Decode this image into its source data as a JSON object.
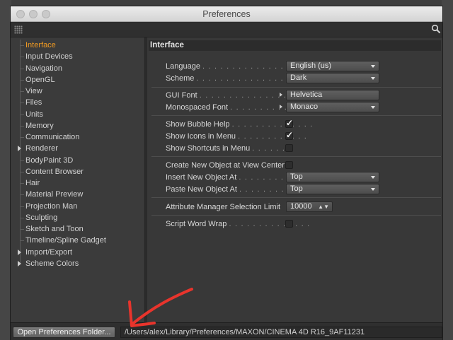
{
  "window": {
    "title": "Preferences"
  },
  "toolbar": {
    "grip_icon": "grip-icon",
    "search_icon": "search-icon"
  },
  "sidebar": {
    "items": [
      {
        "label": "Interface",
        "active": true,
        "expandable": false
      },
      {
        "label": "Input Devices",
        "active": false,
        "expandable": false
      },
      {
        "label": "Navigation",
        "active": false,
        "expandable": false
      },
      {
        "label": "OpenGL",
        "active": false,
        "expandable": false
      },
      {
        "label": "View",
        "active": false,
        "expandable": false
      },
      {
        "label": "Files",
        "active": false,
        "expandable": false
      },
      {
        "label": "Units",
        "active": false,
        "expandable": false
      },
      {
        "label": "Memory",
        "active": false,
        "expandable": false
      },
      {
        "label": "Communication",
        "active": false,
        "expandable": false
      },
      {
        "label": "Renderer",
        "active": false,
        "expandable": true
      },
      {
        "label": "BodyPaint 3D",
        "active": false,
        "expandable": false
      },
      {
        "label": "Content Browser",
        "active": false,
        "expandable": false
      },
      {
        "label": "Hair",
        "active": false,
        "expandable": false
      },
      {
        "label": "Material Preview",
        "active": false,
        "expandable": false
      },
      {
        "label": "Projection Man",
        "active": false,
        "expandable": false
      },
      {
        "label": "Sculpting",
        "active": false,
        "expandable": false
      },
      {
        "label": "Sketch and Toon",
        "active": false,
        "expandable": false
      },
      {
        "label": "Timeline/Spline Gadget",
        "active": false,
        "expandable": false
      },
      {
        "label": "Import/Export",
        "active": false,
        "expandable": true
      },
      {
        "label": "Scheme Colors",
        "active": false,
        "expandable": true
      }
    ]
  },
  "panel": {
    "header": "Interface",
    "language": {
      "label": "Language",
      "value": "English (us)"
    },
    "scheme": {
      "label": "Scheme",
      "value": "Dark"
    },
    "gui_font": {
      "label": "GUI Font",
      "value": "Helvetica"
    },
    "mono_font": {
      "label": "Monospaced Font",
      "value": "Monaco"
    },
    "bubble_help": {
      "label": "Show Bubble Help",
      "checked": true
    },
    "icons_menu": {
      "label": "Show Icons in Menu",
      "checked": true
    },
    "shortcuts_menu": {
      "label": "Show Shortcuts in Menu",
      "checked": false
    },
    "create_center": {
      "label": "Create New Object at View Center",
      "checked": false
    },
    "insert_at": {
      "label": "Insert New Object At",
      "value": "Top"
    },
    "paste_at": {
      "label": "Paste New Object At",
      "value": "Top"
    },
    "attr_limit": {
      "label": "Attribute Manager Selection Limit",
      "value": "10000"
    },
    "word_wrap": {
      "label": "Script Word Wrap",
      "checked": false
    }
  },
  "footer": {
    "open_button": "Open Preferences Folder...",
    "path": "/Users/alex/Library/Preferences/MAXON/CINEMA 4D R16_9AF11231"
  },
  "colors": {
    "accent_active": "#f29b22",
    "annotation_arrow": "#e8342c",
    "panel_bg": "#383838",
    "sidebar_bg": "#3b3b3b"
  }
}
